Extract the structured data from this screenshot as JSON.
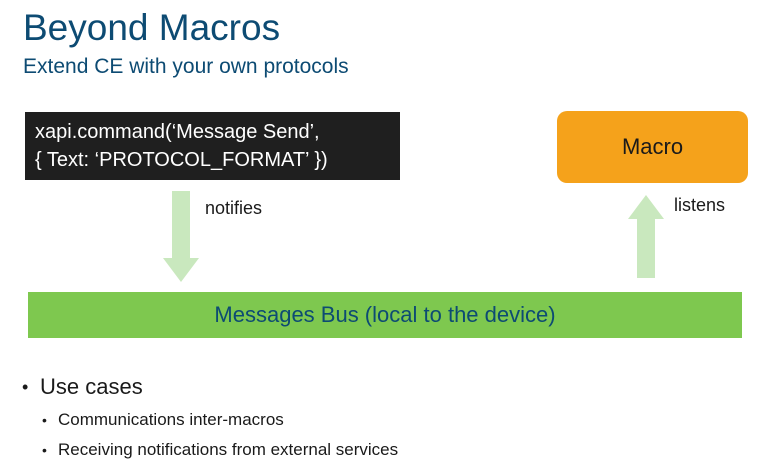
{
  "slide": {
    "title": "Beyond Macros",
    "subtitle": "Extend CE with your own protocols"
  },
  "diagram": {
    "code_lines": [
      "xapi.command(‘Message Send’,",
      "{ Text: ‘PROTOCOL_FORMAT’ })"
    ],
    "macro_label": "Macro",
    "notifies_label": "notifies",
    "listens_label": "listens",
    "bus_label": "Messages Bus (local to the device)"
  },
  "bullets": {
    "heading": "Use cases",
    "items": [
      "Communications inter-macros",
      "Receiving notifications from external services"
    ]
  },
  "colors": {
    "title": "#0d4b73",
    "code_bg": "#1f1f1f",
    "macro_bg": "#f5a21b",
    "bus_bg": "#7ec84f",
    "arrow": "#c9e8be"
  }
}
